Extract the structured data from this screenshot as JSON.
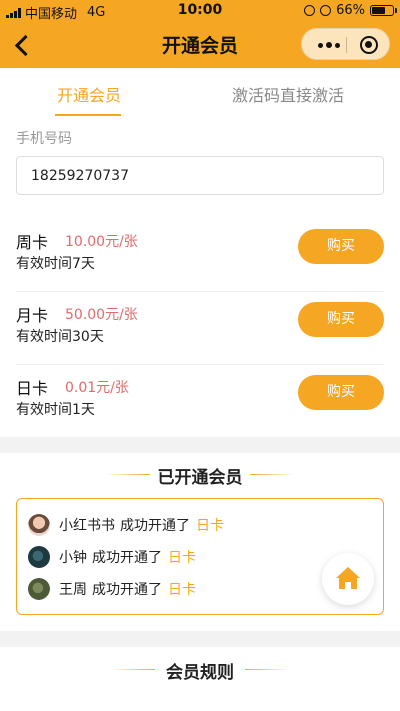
{
  "status_bar": {
    "carrier": "中国移动",
    "network": "4G",
    "time": "10:00",
    "battery": "66%",
    "battery_level": 0.66
  },
  "nav": {
    "title": "开通会员"
  },
  "tabs": [
    {
      "label": "开通会员",
      "active": true
    },
    {
      "label": "激活码直接激活",
      "active": false
    }
  ],
  "form": {
    "phone_label": "手机号码",
    "phone_value": "18259270737"
  },
  "plans": [
    {
      "name": "周卡",
      "price": "10.00元/张",
      "period": "有效时间7天",
      "button": "购买"
    },
    {
      "name": "月卡",
      "price": "50.00元/张",
      "period": "有效时间30天",
      "button": "购买"
    },
    {
      "name": "日卡",
      "price": "0.01元/张",
      "period": "有效时间1天",
      "button": "购买"
    }
  ],
  "members_section": {
    "title": "已开通会员",
    "rows": [
      {
        "user": "小红书书",
        "action": "成功开通了",
        "plan": "日卡"
      },
      {
        "user": "小钟",
        "action": "成功开通了",
        "plan": "日卡"
      },
      {
        "user": "王周",
        "action": "成功开通了",
        "plan": "日卡"
      }
    ]
  },
  "rules_section": {
    "title": "会员规则"
  },
  "colors": {
    "accent": "#f5a623",
    "price": "#e06b6b"
  }
}
